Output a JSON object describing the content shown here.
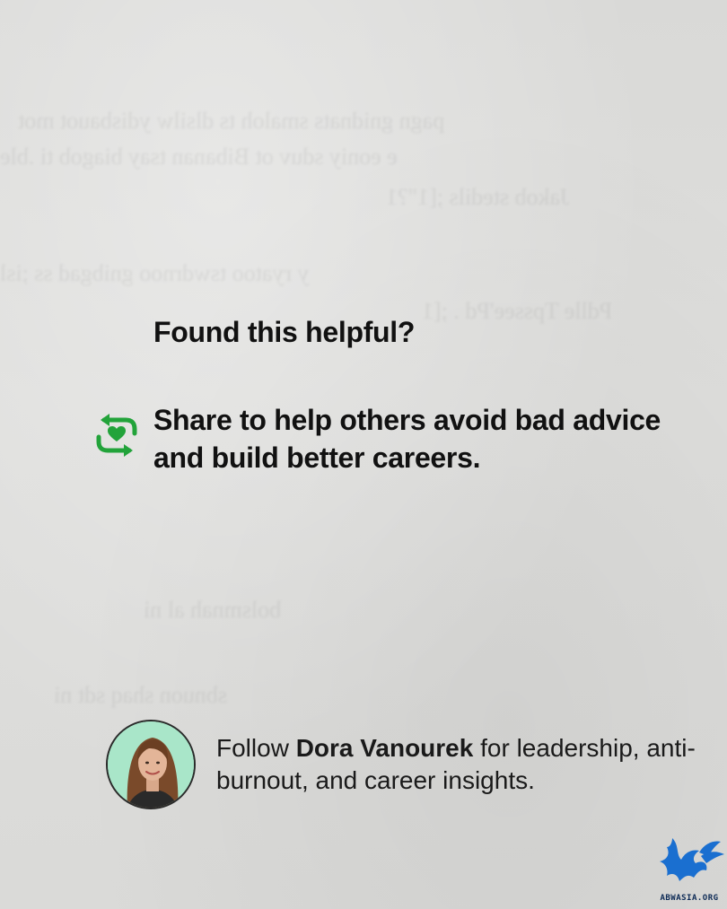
{
  "headline": "Found this helpful?",
  "share": {
    "text": "Share to help others avoid bad advice and build better careers.",
    "icon": "repost-heart-icon",
    "icon_color": "#22a33a"
  },
  "follow": {
    "prefix": "Follow ",
    "name": "Dora Vanourek",
    "suffix": " for leadership, anti-burnout, and career insights.",
    "avatar": "profile-photo",
    "avatar_bg": "#a9e6c9"
  },
  "watermark": {
    "text": "ABWASIA.ORG",
    "icon": "winged-lion-logo",
    "color": "#1a6fd0"
  }
}
